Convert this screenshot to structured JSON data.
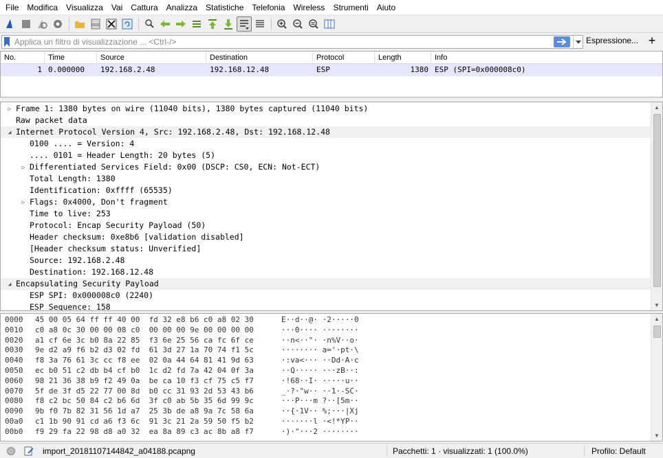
{
  "menu": [
    "File",
    "Modifica",
    "Visualizza",
    "Vai",
    "Cattura",
    "Analizza",
    "Statistiche",
    "Telefonia",
    "Wireless",
    "Strumenti",
    "Aiuto"
  ],
  "filter": {
    "placeholder": "Applica un filtro di visualizzazione ... <Ctrl-/>",
    "value": "",
    "expression_label": "Espressione...",
    "plus_label": "+"
  },
  "packet_list": {
    "columns": [
      "No.",
      "Time",
      "Source",
      "Destination",
      "Protocol",
      "Length",
      "Info"
    ],
    "rows": [
      {
        "no": "1",
        "time": "0.000000",
        "source": "192.168.2.48",
        "destination": "192.168.12.48",
        "protocol": "ESP",
        "length": "1380",
        "info": "ESP (SPI=0x000008c0)"
      }
    ]
  },
  "detail": [
    "Frame 1: 1380 bytes on wire (11040 bits), 1380 bytes captured (11040 bits)",
    "Raw packet data",
    "Internet Protocol Version 4, Src: 192.168.2.48, Dst: 192.168.12.48",
    "0100 .... = Version: 4",
    ".... 0101 = Header Length: 20 bytes (5)",
    "Differentiated Services Field: 0x00 (DSCP: CS0, ECN: Not-ECT)",
    "Total Length: 1380",
    "Identification: 0xffff (65535)",
    "Flags: 0x4000, Don't fragment",
    "Time to live: 253",
    "Protocol: Encap Security Payload (50)",
    "Header checksum: 0xe8b6 [validation disabled]",
    "[Header checksum status: Unverified]",
    "Source: 192.168.2.48",
    "Destination: 192.168.12.48",
    "Encapsulating Security Payload",
    "ESP SPI: 0x000008c0 (2240)",
    "ESP Sequence: 158"
  ],
  "bytes": [
    {
      "offset": "0000",
      "hex": "45 00 05 64 ff ff 40 00  fd 32 e8 b6 c0 a8 02 30",
      "ascii": "E··d··@· ·2·····0"
    },
    {
      "offset": "0010",
      "hex": "c0 a8 0c 30 00 00 08 c0  00 00 00 9e 00 00 00 00",
      "ascii": "···0···· ········"
    },
    {
      "offset": "0020",
      "hex": "a1 cf 6e 3c b0 8a 22 85  f3 6e 25 56 ca fc 6f ce",
      "ascii": "··n<··\"· ·n%V··o·"
    },
    {
      "offset": "0030",
      "hex": "9e d2 a9 f6 b2 d3 02 fd  61 3d 27 1a 70 74 f1 5c",
      "ascii": "········ a='·pt·\\"
    },
    {
      "offset": "0040",
      "hex": "f8 3a 76 61 3c cc f8 ee  02 0a 44 64 81 41 9d 63",
      "ascii": "·:va<··· ··Dd·A·c"
    },
    {
      "offset": "0050",
      "hex": "ec b0 51 c2 db b4 cf b0  1c d2 fd 7a 42 04 0f 3a",
      "ascii": "··Q····· ···zB··:"
    },
    {
      "offset": "0060",
      "hex": "98 21 36 38 b9 f2 49 0a  be ca 10 f3 cf 75 c5 f7",
      "ascii": "·!68··I· ·····u··"
    },
    {
      "offset": "0070",
      "hex": "5f de 3f d5 22 77 00 8d  b0 cc 31 93 2d 53 43 b6",
      "ascii": "_·?·\"w·· ··1·-SC·"
    },
    {
      "offset": "0080",
      "hex": "f8 c2 bc 50 84 c2 b6 6d  3f c0 ab 5b 35 6d 99 9c",
      "ascii": "···P···m ?··[5m··"
    },
    {
      "offset": "0090",
      "hex": "9b f0 7b 82 31 56 1d a7  25 3b de a8 9a 7c 58 6a",
      "ascii": "··{·1V·· %;···|Xj"
    },
    {
      "offset": "00a0",
      "hex": "c1 1b 90 91 cd a6 f3 6c  91 3c 21 2a 59 50 f5 b2",
      "ascii": "·······l ·<!*YP··"
    },
    {
      "offset": "00b0",
      "hex": "f9 29 fa 22 98 d8 a0 32  ea 8a 89 c3 ac 8b a8 f7",
      "ascii": "·)·\"···2 ········"
    }
  ],
  "status": {
    "file": "import_20181107144842_a04188.pcapng",
    "packets": "Pacchetti: 1 · visualizzati: 1 (100.0%)",
    "profile": "Profilo: Default"
  },
  "colors": {
    "selected_row": "#e7e6ff",
    "apply_button": "#5a8fd8",
    "highlight_line": "#f0f0f0"
  }
}
